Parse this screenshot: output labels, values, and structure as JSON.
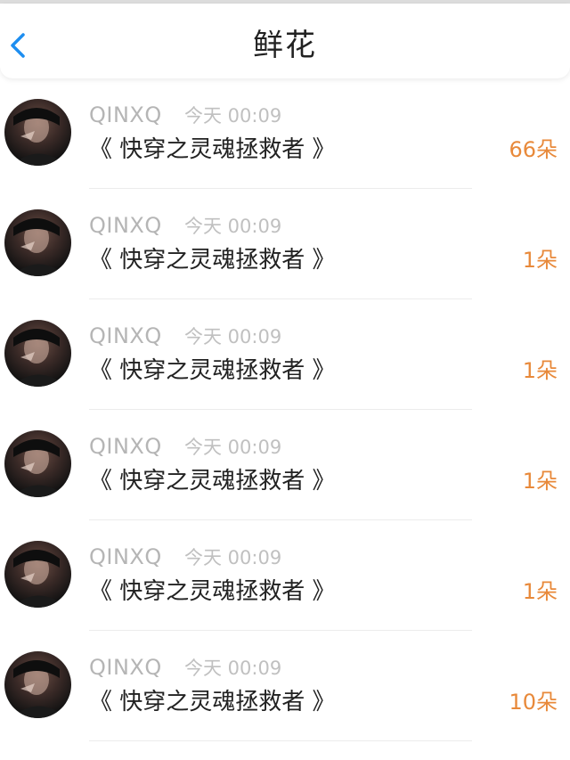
{
  "header": {
    "title": "鲜花",
    "back_icon": "chevron-left-icon",
    "accent": "#1e8ef0"
  },
  "rows": [
    {
      "user": "QINXQ",
      "time": "今天 00:09",
      "book": "《 快穿之灵魂拯救者 》",
      "count": "66朵"
    },
    {
      "user": "QINXQ",
      "time": "今天 00:09",
      "book": "《 快穿之灵魂拯救者 》",
      "count": "1朵"
    },
    {
      "user": "QINXQ",
      "time": "今天 00:09",
      "book": "《 快穿之灵魂拯救者 》",
      "count": "1朵"
    },
    {
      "user": "QINXQ",
      "time": "今天 00:09",
      "book": "《 快穿之灵魂拯救者 》",
      "count": "1朵"
    },
    {
      "user": "QINXQ",
      "time": "今天 00:09",
      "book": "《 快穿之灵魂拯救者 》",
      "count": "1朵"
    },
    {
      "user": "QINXQ",
      "time": "今天 00:09",
      "book": "《 快穿之灵魂拯救者 》",
      "count": "10朵"
    }
  ],
  "colors": {
    "count": "#e8893a",
    "name": "#b5b5b5"
  }
}
